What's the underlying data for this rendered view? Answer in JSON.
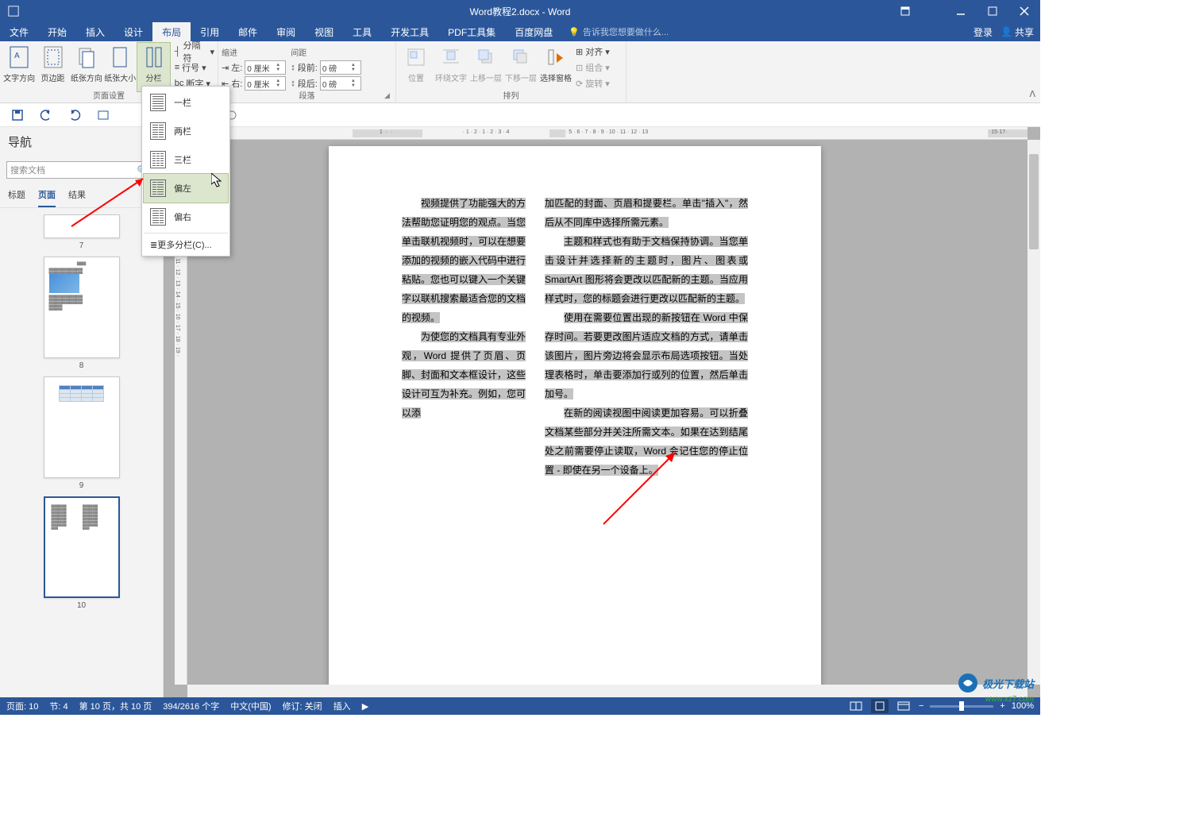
{
  "title": "Word教程2.docx - Word",
  "tabs": [
    "文件",
    "开始",
    "插入",
    "设计",
    "布局",
    "引用",
    "邮件",
    "审阅",
    "视图",
    "工具",
    "开发工具",
    "PDF工具集",
    "百度网盘"
  ],
  "active_tab": "布局",
  "tell_me": "告诉我您想要做什么...",
  "right_actions": {
    "login": "登录",
    "share": "共享"
  },
  "ribbon": {
    "page_setup": {
      "label": "页面设置",
      "buttons": {
        "text_dir": "文字方向",
        "margins": "页边距",
        "orientation": "纸张方向",
        "size": "纸张大小",
        "columns": "分栏"
      },
      "breaks": "分隔符",
      "line_numbers": "行号",
      "hyphenation": "断字"
    },
    "paragraph": {
      "label": "段落",
      "indent_label": "缩进",
      "spacing_label": "间距",
      "indent_left_label": "左:",
      "indent_left_val": "0 厘米",
      "indent_right_label": "右:",
      "indent_right_val": "0 厘米",
      "space_before_label": "段前:",
      "space_before_val": "0 磅",
      "space_after_label": "段后:",
      "space_after_val": "0 磅"
    },
    "arrange": {
      "label": "排列",
      "position": "位置",
      "wrap": "环绕文字",
      "bring_fwd": "上移一层",
      "send_back": "下移一层",
      "selection": "选择窗格",
      "align": "对齐",
      "group": "组合",
      "rotate": "旋转"
    }
  },
  "columns_menu": {
    "items": [
      "一栏",
      "两栏",
      "三栏",
      "偏左",
      "偏右"
    ],
    "more": "更多分栏(C)...",
    "hover_index": 3
  },
  "nav": {
    "title": "导航",
    "search_placeholder": "搜索文档",
    "tabs": [
      "标题",
      "页面",
      "结果"
    ],
    "active_tab": "页面",
    "pages": [
      "7",
      "8",
      "9",
      "10"
    ],
    "selected_page": "10"
  },
  "document": {
    "col1": "视频提供了功能强大的方法帮助您证明您的观点。当您单击联机视频时，可以在想要添加的视频的嵌入代码中进行粘贴。您也可以键入一个关键字以联机搜索最适合您的文档的视频。",
    "col1b": "为使您的文档具有专业外观，Word 提供了页眉、页脚、封面和文本框设计，这些设计可互为补充。例如，您可以添",
    "col2": "加匹配的封面、页眉和提要栏。单击\"插入\"，然后从不同库中选择所需元素。",
    "col2b": "主题和样式也有助于文档保持协调。当您单击设计并选择新的主题时，图片、图表或 SmartArt 图形将会更改以匹配新的主题。当应用样式时，您的标题会进行更改以匹配新的主题。",
    "col2c": "使用在需要位置出现的新按钮在 Word 中保存时间。若要更改图片适应文档的方式，请单击该图片，图片旁边将会显示布局选项按钮。当处理表格时，单击要添加行或列的位置，然后单击加号。",
    "col2d": "在新的阅读视图中阅读更加容易。可以折叠文档某些部分并关注所需文本。如果在达到结尾处之前需要停止读取，Word 会记住您的停止位置 - 即使在另一个设备上。"
  },
  "ruler_numbers_h": [
    "1",
    "",
    "1",
    "2",
    "1",
    "2",
    "3",
    "4",
    "5",
    "6",
    "7",
    "8",
    "9",
    "10",
    "11",
    "12",
    "13",
    "17"
  ],
  "statusbar": {
    "page": "页面: 10",
    "section": "节: 4",
    "page_count": "第 10 页，共 10 页",
    "words": "394/2616 个字",
    "lang": "中文(中国)",
    "track": "修订: 关闭",
    "insert": "插入",
    "zoom": "100%"
  },
  "watermark": {
    "text": "极光下载站",
    "url": "www.xz7.com"
  }
}
